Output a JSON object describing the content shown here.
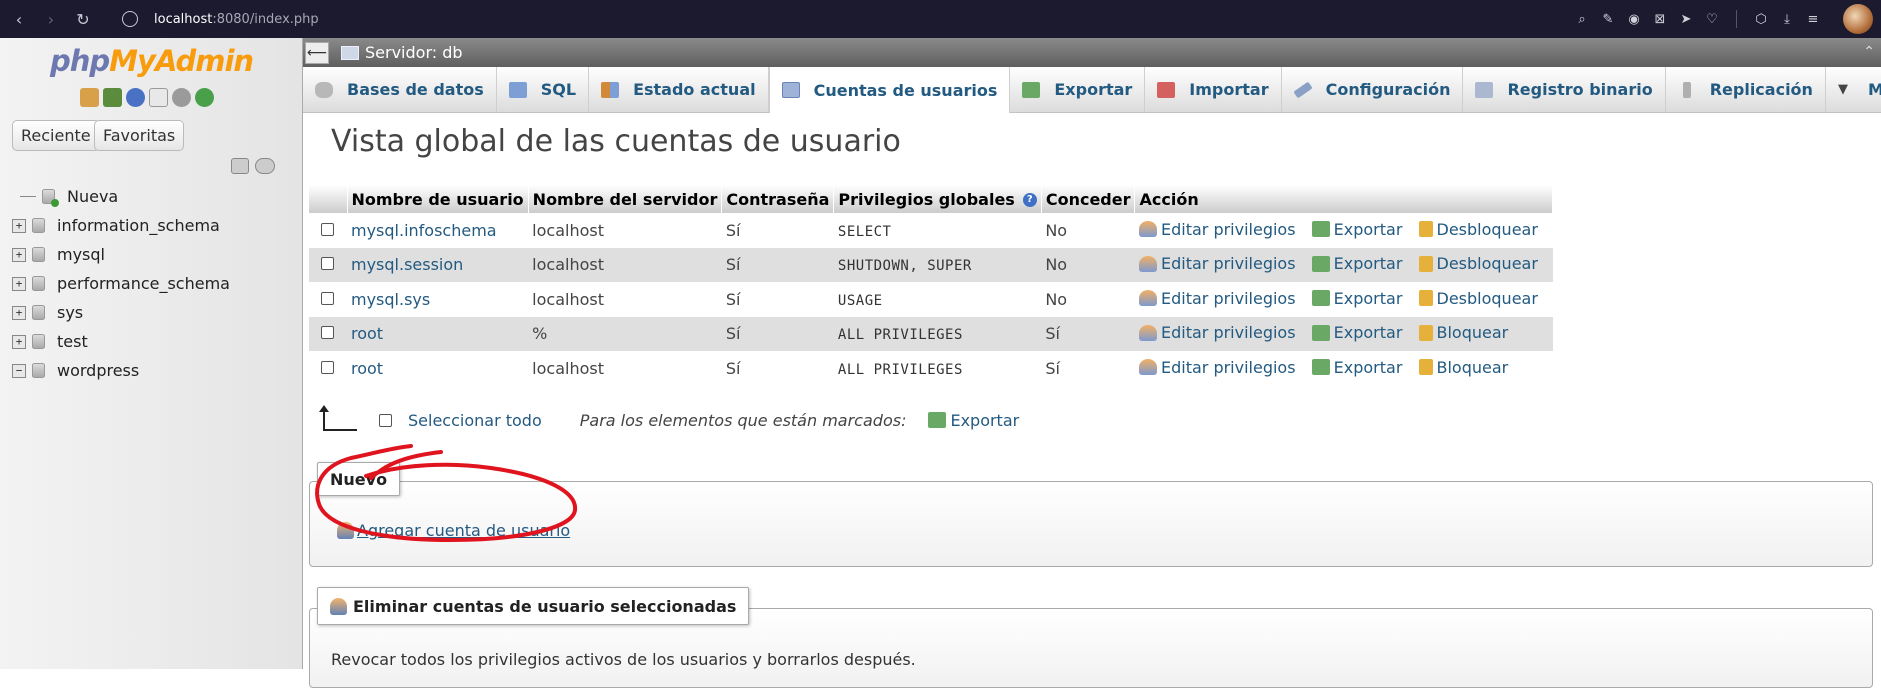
{
  "browser": {
    "url_host": "localhost",
    "url_rest": ":8080/index.php",
    "icons": [
      "back-icon",
      "forward-icon",
      "reload-icon",
      "globe-icon",
      "zoom-icon",
      "edit-icon",
      "camera-icon",
      "close-icon",
      "send-icon",
      "heart-icon",
      "cube-icon",
      "download-icon",
      "menu-icon"
    ]
  },
  "nav": {
    "logo_php": "php",
    "logo_my": "My",
    "logo_admin": "Admin",
    "recent_label": "Reciente",
    "favorites_label": "Favoritas",
    "tree": [
      {
        "label": "Nueva",
        "type": "new"
      },
      {
        "label": "information_schema",
        "type": "db",
        "expander": "+"
      },
      {
        "label": "mysql",
        "type": "db",
        "expander": "+"
      },
      {
        "label": "performance_schema",
        "type": "db",
        "expander": "+"
      },
      {
        "label": "sys",
        "type": "db",
        "expander": "+"
      },
      {
        "label": "test",
        "type": "db",
        "expander": "+"
      },
      {
        "label": "wordpress",
        "type": "db",
        "expander": "−"
      }
    ]
  },
  "server_bar": {
    "back_glyph": "⟵",
    "title": "Servidor: db"
  },
  "tabs": [
    {
      "label": "Bases de datos",
      "icon": "databases-icon",
      "color": "#a0a0a0"
    },
    {
      "label": "SQL",
      "icon": "sql-icon",
      "color": "#5a7fc0"
    },
    {
      "label": "Estado actual",
      "icon": "status-icon",
      "color": "#d28a3a"
    },
    {
      "label": "Cuentas de usuarios",
      "icon": "user-accounts-icon",
      "color": "#7893c7",
      "active": true
    },
    {
      "label": "Exportar",
      "icon": "export-icon",
      "color": "#4f8f4a"
    },
    {
      "label": "Importar",
      "icon": "import-icon",
      "color": "#c24848"
    },
    {
      "label": "Configuración",
      "icon": "wrench-icon",
      "color": "#6b7ea8"
    },
    {
      "label": "Registro binario",
      "icon": "binlog-icon",
      "color": "#8a9bb8"
    },
    {
      "label": "Replicación",
      "icon": "replication-icon",
      "color": "#9a9a9a"
    },
    {
      "label": "Más",
      "icon": "more-icon",
      "color": "#444444"
    }
  ],
  "page": {
    "title": "Vista global de las cuentas de usuario"
  },
  "users_table": {
    "headers": [
      "Nombre de usuario",
      "Nombre del servidor",
      "Contraseña",
      "Privilegios globales",
      "Conceder",
      "Acción"
    ],
    "rows": [
      {
        "user": "mysql.infoschema",
        "host": "localhost",
        "password": "Sí",
        "privileges": "SELECT",
        "grant": "No",
        "edit": "Editar privilegios",
        "export": "Exportar",
        "lock": "Desbloquear"
      },
      {
        "user": "mysql.session",
        "host": "localhost",
        "password": "Sí",
        "privileges": "SHUTDOWN, SUPER",
        "grant": "No",
        "edit": "Editar privilegios",
        "export": "Exportar",
        "lock": "Desbloquear"
      },
      {
        "user": "mysql.sys",
        "host": "localhost",
        "password": "Sí",
        "privileges": "USAGE",
        "grant": "No",
        "edit": "Editar privilegios",
        "export": "Exportar",
        "lock": "Desbloquear"
      },
      {
        "user": "root",
        "host": "%",
        "password": "Sí",
        "privileges": "ALL PRIVILEGES",
        "grant": "Sí",
        "edit": "Editar privilegios",
        "export": "Exportar",
        "lock": "Bloquear"
      },
      {
        "user": "root",
        "host": "localhost",
        "password": "Sí",
        "privileges": "ALL PRIVILEGES",
        "grant": "Sí",
        "edit": "Editar privilegios",
        "export": "Exportar",
        "lock": "Bloquear"
      }
    ]
  },
  "bulk": {
    "select_all": "Seleccionar todo",
    "marked_label": "Para los elementos que están marcados:",
    "export": "Exportar"
  },
  "new_section": {
    "legend": "Nuevo",
    "add_user": "Agregar cuenta de usuario"
  },
  "delete_section": {
    "legend": "Eliminar cuentas de usuario seleccionadas",
    "revoke_text": "Revocar todos los privilegios activos de los usuarios y borrarlos después."
  },
  "colors": {
    "link": "#235a81",
    "annotation_circle": "#e0141e",
    "browser_bar": "#1b1a2e"
  }
}
